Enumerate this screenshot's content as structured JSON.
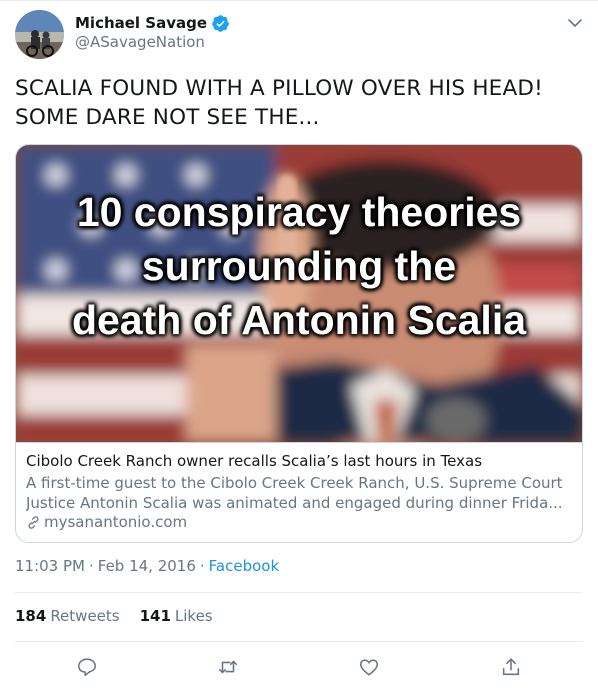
{
  "user": {
    "display_name": "Michael Savage",
    "handle": "@ASavageNation",
    "verified": true
  },
  "tweet": {
    "text_line1": "SCALIA FOUND WITH A PILLOW OVER HIS HEAD!",
    "text_line2": "SOME DARE NOT SEE THE..."
  },
  "card": {
    "image_text": [
      "10 conspiracy theories",
      "surrounding the",
      "death of Antonin Scalia"
    ],
    "title": "Cibolo Creek Ranch owner recalls Scalia’s last hours in Texas",
    "description_line1": "A first-time guest to the Cibolo Creek Creek Ranch, U.S. Supreme Court",
    "description_line2": "Justice Antonin Scalia was animated and engaged during dinner Frida...",
    "domain": "mysanantonio.com"
  },
  "meta": {
    "time": "11:03 PM",
    "date": "Feb 14, 2016",
    "source": "Facebook"
  },
  "stats": {
    "retweets_count": "184",
    "retweets_label": "Retweets",
    "likes_count": "141",
    "likes_label": "Likes"
  },
  "icons": {
    "verified": "verified-badge-icon",
    "caret": "chevron-down-icon",
    "link": "link-icon",
    "reply": "reply-icon",
    "retweet": "retweet-icon",
    "like": "heart-icon",
    "share": "share-icon"
  },
  "colors": {
    "text": "#14171a",
    "secondary": "#657786",
    "accent": "#1da1f2",
    "link": "#1b95e0",
    "border": "#ccd6dd",
    "divider": "#e6ecf0"
  }
}
